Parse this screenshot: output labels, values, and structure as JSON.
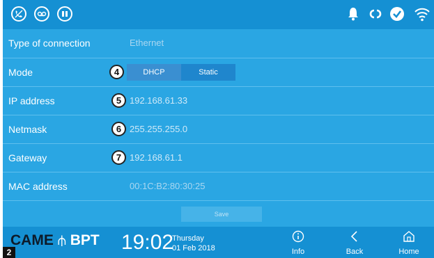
{
  "statusbar": {
    "left_icons": [
      "phone-mute-icon",
      "voicemail-icon",
      "pause-icon"
    ],
    "right_icons": [
      "bell-icon",
      "link-icon",
      "check-icon",
      "wifi-icon"
    ]
  },
  "rows": [
    {
      "label": "Type of connection",
      "value": "Ethernet",
      "callout": ""
    },
    {
      "label": "Mode",
      "value": "",
      "callout": "4"
    },
    {
      "label": "IP address",
      "value": "192.168.61.33",
      "callout": "5"
    },
    {
      "label": "Netmask",
      "value": "255.255.255.0",
      "callout": "6"
    },
    {
      "label": "Gateway",
      "value": "192.168.61.1",
      "callout": "7"
    },
    {
      "label": "MAC address",
      "value": "00:1C:B2:80:30:25",
      "callout": ""
    }
  ],
  "mode": {
    "dhcp_label": "DHCP",
    "static_label": "Static",
    "selected": "DHCP"
  },
  "save_label": "Save",
  "bottombar": {
    "logo_left": "CAME",
    "logo_right": "BPT",
    "time": "19:02",
    "day": "Thursday",
    "date": "01 Feb 2018",
    "nav": [
      {
        "label": "Info",
        "icon": "info-icon"
      },
      {
        "label": "Back",
        "icon": "back-arrow-icon"
      },
      {
        "label": "Home",
        "icon": "home-icon"
      }
    ]
  },
  "figure_badge": "2",
  "colors": {
    "panel": "#2aa6e3",
    "bar": "#1590d3",
    "selected": "#3a8fd1"
  }
}
